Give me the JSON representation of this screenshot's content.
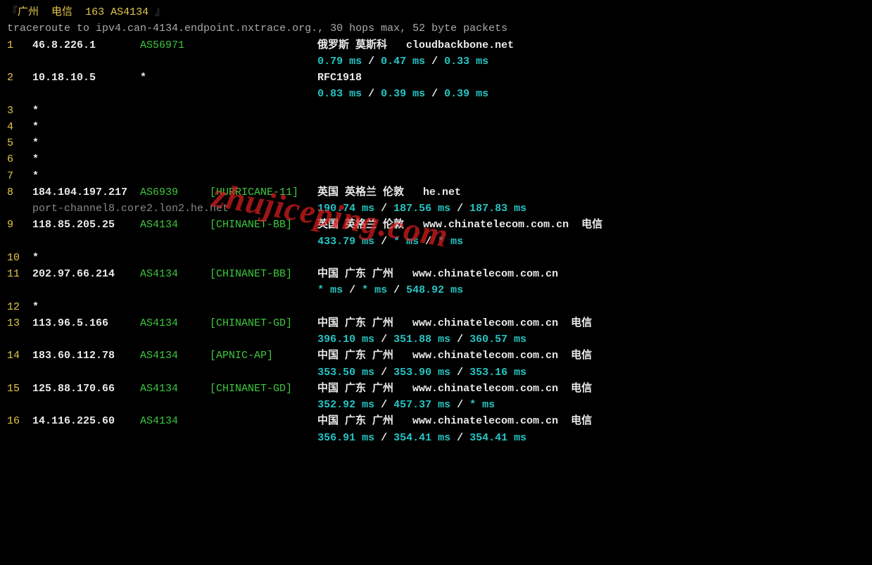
{
  "header": {
    "open": "『",
    "loc": "广州",
    "isp": "电信",
    "net": "163 AS4134",
    "close": "』"
  },
  "cmd": "traceroute to ipv4.can-4134.endpoint.nxtrace.org., 30 hops max, 52 byte packets",
  "watermark": "zhujiceping.com",
  "hops": [
    {
      "n": "1",
      "ip": "46.8.226.1",
      "asn": "AS56971",
      "tag": "",
      "geo": "俄罗斯 莫斯科   cloudbackbone.net",
      "rtt": [
        "0.79 ms",
        "0.47 ms",
        "0.33 ms"
      ]
    },
    {
      "n": "2",
      "ip": "10.18.10.5",
      "asn": "*",
      "tag": "",
      "geo": "RFC1918",
      "rtt": [
        "0.83 ms",
        "0.39 ms",
        "0.39 ms"
      ]
    },
    {
      "n": "3",
      "ip": "*"
    },
    {
      "n": "4",
      "ip": "*"
    },
    {
      "n": "5",
      "ip": "*"
    },
    {
      "n": "6",
      "ip": "*"
    },
    {
      "n": "7",
      "ip": "*"
    },
    {
      "n": "8",
      "ip": "184.104.197.217",
      "asn": "AS6939",
      "tag": "[HURRICANE-11]",
      "geo": "英国 英格兰 伦敦   he.net",
      "rtt": [
        "190.74 ms",
        "187.56 ms",
        "187.83 ms"
      ],
      "rdns": "port-channel8.core2.lon2.he.net"
    },
    {
      "n": "9",
      "ip": "118.85.205.25",
      "asn": "AS4134",
      "tag": "[CHINANET-BB]",
      "geo": "英国 英格兰 伦敦   www.chinatelecom.com.cn  电信",
      "rtt": [
        "433.79 ms",
        "* ms",
        "* ms"
      ]
    },
    {
      "n": "10",
      "ip": "*"
    },
    {
      "n": "11",
      "ip": "202.97.66.214",
      "asn": "AS4134",
      "tag": "[CHINANET-BB]",
      "geo": "中国 广东 广州   www.chinatelecom.com.cn",
      "rtt": [
        "* ms",
        "* ms",
        "548.92 ms"
      ]
    },
    {
      "n": "12",
      "ip": "*"
    },
    {
      "n": "13",
      "ip": "113.96.5.166",
      "asn": "AS4134",
      "tag": "[CHINANET-GD]",
      "geo": "中国 广东 广州   www.chinatelecom.com.cn  电信",
      "rtt": [
        "396.10 ms",
        "351.88 ms",
        "360.57 ms"
      ]
    },
    {
      "n": "14",
      "ip": "183.60.112.78",
      "asn": "AS4134",
      "tag": "[APNIC-AP]",
      "geo": "中国 广东 广州   www.chinatelecom.com.cn  电信",
      "rtt": [
        "353.50 ms",
        "353.90 ms",
        "353.16 ms"
      ]
    },
    {
      "n": "15",
      "ip": "125.88.170.66",
      "asn": "AS4134",
      "tag": "[CHINANET-GD]",
      "geo": "中国 广东 广州   www.chinatelecom.com.cn  电信",
      "rtt": [
        "352.92 ms",
        "457.37 ms",
        "* ms"
      ]
    },
    {
      "n": "16",
      "ip": "14.116.225.60",
      "asn": "AS4134",
      "tag": "",
      "geo": "中国 广东 广州   www.chinatelecom.com.cn  电信",
      "rtt": [
        "356.91 ms",
        "354.41 ms",
        "354.41 ms"
      ]
    }
  ],
  "sep": " / "
}
